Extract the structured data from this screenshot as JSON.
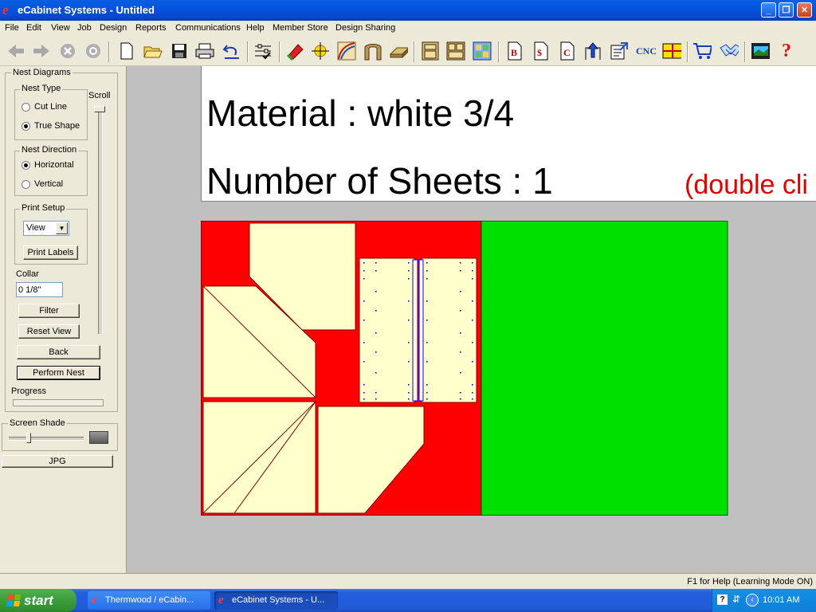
{
  "window": {
    "title": "eCabinet Systems - Untitled",
    "min_glyph": "_",
    "max_glyph": "❐",
    "close_glyph": "✕"
  },
  "menu": [
    "File",
    "Edit",
    "View",
    "Job",
    "Design",
    "Reports",
    "Communications",
    "Help",
    "Member Store",
    "Design Sharing"
  ],
  "toolbar": {
    "cnc_label": "CNC",
    "icons": [
      "back-arrow-icon",
      "forward-arrow-icon",
      "stop-icon",
      "refresh-icon",
      "new-file-icon",
      "open-folder-icon",
      "save-disk-icon",
      "print-icon",
      "undo-icon",
      "settings-checklist-icon",
      "measure-tape-icon",
      "snap-point-icon",
      "curve-tool-icon",
      "arch-icon",
      "panel-3d-icon",
      "cabinet-base-icon",
      "cabinet-wall-icon",
      "texture-grid-icon",
      "report-b-icon",
      "report-cost-icon",
      "report-c-icon",
      "upload-icon",
      "export-form-icon",
      "cnc-text-icon",
      "layout-icon",
      "shopping-cart-icon",
      "handshake-icon",
      "video-icon",
      "help-question-icon"
    ]
  },
  "left": {
    "title": "Nest Diagrams",
    "nest_type": {
      "legend": "Nest Type",
      "options": [
        "Cut Line",
        "True Shape"
      ],
      "selected": 1
    },
    "scroll_label": "Scroll",
    "nest_direction": {
      "legend": "Nest Direction",
      "options": [
        "Horizontal",
        "Vertical"
      ],
      "selected": 0
    },
    "print_setup": {
      "legend": "Print Setup",
      "select_value": "View",
      "print_labels": "Print Labels"
    },
    "collar_label": "Collar",
    "collar_value": "0 1/8\"",
    "buttons": {
      "filter": "Filter",
      "reset_view": "Reset View",
      "back": "Back",
      "perform_nest": "Perform Nest"
    },
    "progress_label": "Progress",
    "progress_value": 0,
    "screen_shade": "Screen Shade",
    "shade_level": 0.25,
    "jpg": "JPG"
  },
  "canvas": {
    "material_line": "Material :  white 3/4",
    "sheets_line": "Number of Sheets :  1",
    "hint_line": "(double cli",
    "colors": {
      "sheet_bg": "#ff0000",
      "waste": "#00e000",
      "part": "#ffffcc",
      "hole": "#0000ff"
    }
  },
  "status": {
    "help_text": "F1 for Help (Learning Mode ON)"
  },
  "taskbar": {
    "start": "start",
    "tasks": [
      {
        "label": "Thermwood / eCabin..."
      },
      {
        "label": "eCabinet Systems - U..."
      }
    ],
    "clock": "10:01 AM"
  }
}
